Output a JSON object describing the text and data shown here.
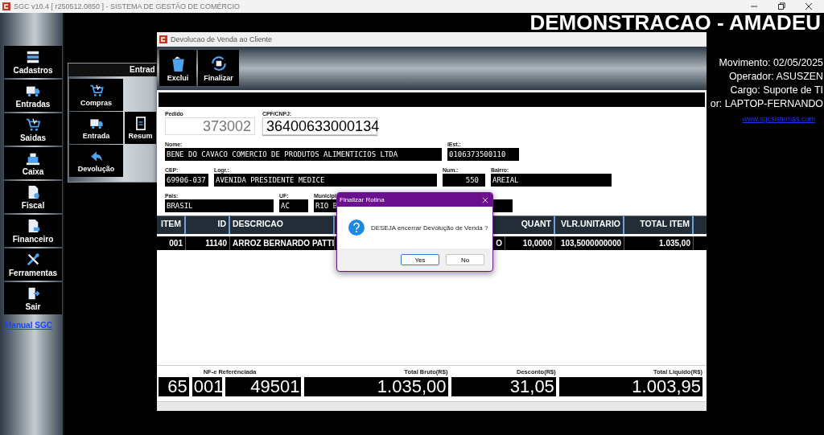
{
  "os_window": {
    "title": "SGC v10.4 [ r250512.0850 ] - SISTEMA DE GESTÃO DE COMÉRCIO"
  },
  "sidebar": {
    "items": [
      {
        "label": "Cadastros"
      },
      {
        "label": "Entradas"
      },
      {
        "label": "Saidas"
      },
      {
        "label": "Caixa"
      },
      {
        "label": "Fiscal"
      },
      {
        "label": "Financeiro"
      },
      {
        "label": "Ferramentas"
      },
      {
        "label": "Sair"
      }
    ],
    "link": "Manual SGC"
  },
  "header": {
    "title": "DEMONSTRACAO - AMADEU",
    "lines": [
      "Movimento: 02/05/2025",
      "Operador: ASUSZEN",
      "Cargo: Suporte de TI",
      "or: LAPTOP-FERNANDO"
    ],
    "website": "www.sgcsistemas.com"
  },
  "submenu": {
    "title": "Entrad",
    "buttons": [
      {
        "label": "Compras"
      },
      {
        "label": "Entrada"
      },
      {
        "label": "Resum"
      },
      {
        "label": "Devolução"
      }
    ]
  },
  "window": {
    "title": "Devolucao de Venda ao Cliente",
    "toolbar": [
      {
        "label": "Exclui"
      },
      {
        "label": "Finalizar"
      }
    ],
    "order": {
      "label": "Pedido",
      "value": "373002",
      "disabled": true
    },
    "document": {
      "label": "CPF/CNPJ:",
      "value": "36400633000134"
    },
    "fields": [
      [
        {
          "label": "Nome:",
          "value": "BENE DO CAVACO COMERCIO DE PRODUTOS ALIMENTICIOS LTDA"
        },
        {
          "label": "IEst.:",
          "value": "0106373500110"
        }
      ],
      [
        {
          "label": "CEP:",
          "value": "69906-037"
        },
        {
          "label": "Logr.:",
          "value": "AVENIDA PRESIDENTE MEDICE"
        },
        {
          "label": "Num.:",
          "value": "550"
        },
        {
          "label": "Bairro:",
          "value": "AREIAL"
        }
      ],
      [
        {
          "label": "Pais:",
          "value": "BRASIL"
        },
        {
          "label": "UF:",
          "value": "AC"
        },
        {
          "label": "Municipi",
          "value": "RIO B"
        }
      ]
    ],
    "table": {
      "columns": [
        "ITEM",
        "ID",
        "DESCRICAO",
        "",
        "QUANT",
        "VLR.UNITARIO",
        "TOTAL ITEM"
      ],
      "rows": [
        {
          "selected": true,
          "cells": [
            "001",
            "11140",
            "ARROZ BERNARDO PATTI",
            "O",
            "10,0000",
            "103,5000000000",
            "1.035,00"
          ]
        }
      ]
    },
    "nfe": {
      "label": "NF-e Referênciada",
      "values": [
        "65",
        "001",
        "49501"
      ]
    },
    "totals": [
      {
        "label": "Total Bruto(R$)",
        "value": "1.035,00"
      },
      {
        "label": "Desconto(R$)",
        "value": "31,05"
      },
      {
        "label": "Total Liquido(R$)",
        "value": "1.003,95"
      }
    ]
  },
  "dialog": {
    "title": "Finalizar Rotina",
    "message": "DESEJA encerrar Devolução de Venda ?",
    "buttons": [
      {
        "label": "Yes",
        "selected": true
      },
      {
        "label": "No",
        "selected": false
      }
    ]
  }
}
